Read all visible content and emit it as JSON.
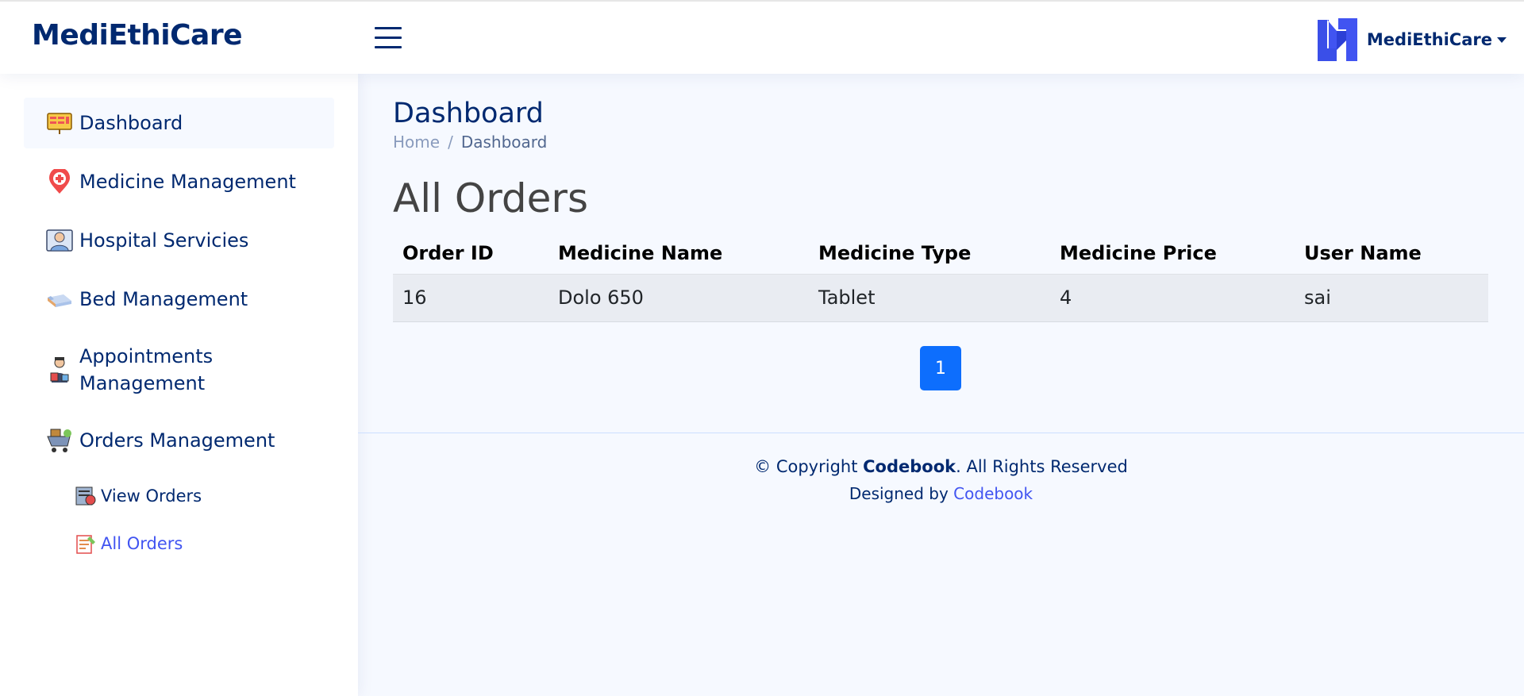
{
  "header": {
    "logo": "MediEthiCare",
    "profile_name": "MediEthiCare"
  },
  "sidebar": {
    "items": [
      {
        "label": "Dashboard",
        "icon": "dashboard-icon"
      },
      {
        "label": "Medicine Management",
        "icon": "medical-pin-icon"
      },
      {
        "label": "Hospital Servicies",
        "icon": "doctor-icon"
      },
      {
        "label": "Bed Management",
        "icon": "bed-icon"
      },
      {
        "label": "Appointments Management",
        "icon": "appointment-icon"
      },
      {
        "label": "Orders Management",
        "icon": "cart-icon"
      }
    ],
    "sub_items": [
      {
        "label": "View Orders",
        "icon": "view-orders-icon"
      },
      {
        "label": "All Orders",
        "icon": "clipboard-icon"
      }
    ]
  },
  "main": {
    "page_title": "Dashboard",
    "breadcrumb": {
      "home": "Home",
      "separator": "/",
      "current": "Dashboard"
    },
    "section_title": "All Orders",
    "table": {
      "headers": [
        "Order ID",
        "Medicine Name",
        "Medicine Type",
        "Medicine Price",
        "User Name"
      ],
      "rows": [
        [
          "16",
          "Dolo 650",
          "Tablet",
          "4",
          "sai"
        ]
      ]
    },
    "pagination": {
      "current_page": "1"
    }
  },
  "footer": {
    "copyright_prefix": "© Copyright",
    "copyright_brand": "Codebook",
    "copyright_suffix": ". All Rights Reserved",
    "designed_prefix": "Designed by",
    "designed_link": "Codebook"
  },
  "colors": {
    "primary": "#012970",
    "accent": "#4154f1",
    "pager": "#0d6efd",
    "background": "#f6f9ff"
  }
}
